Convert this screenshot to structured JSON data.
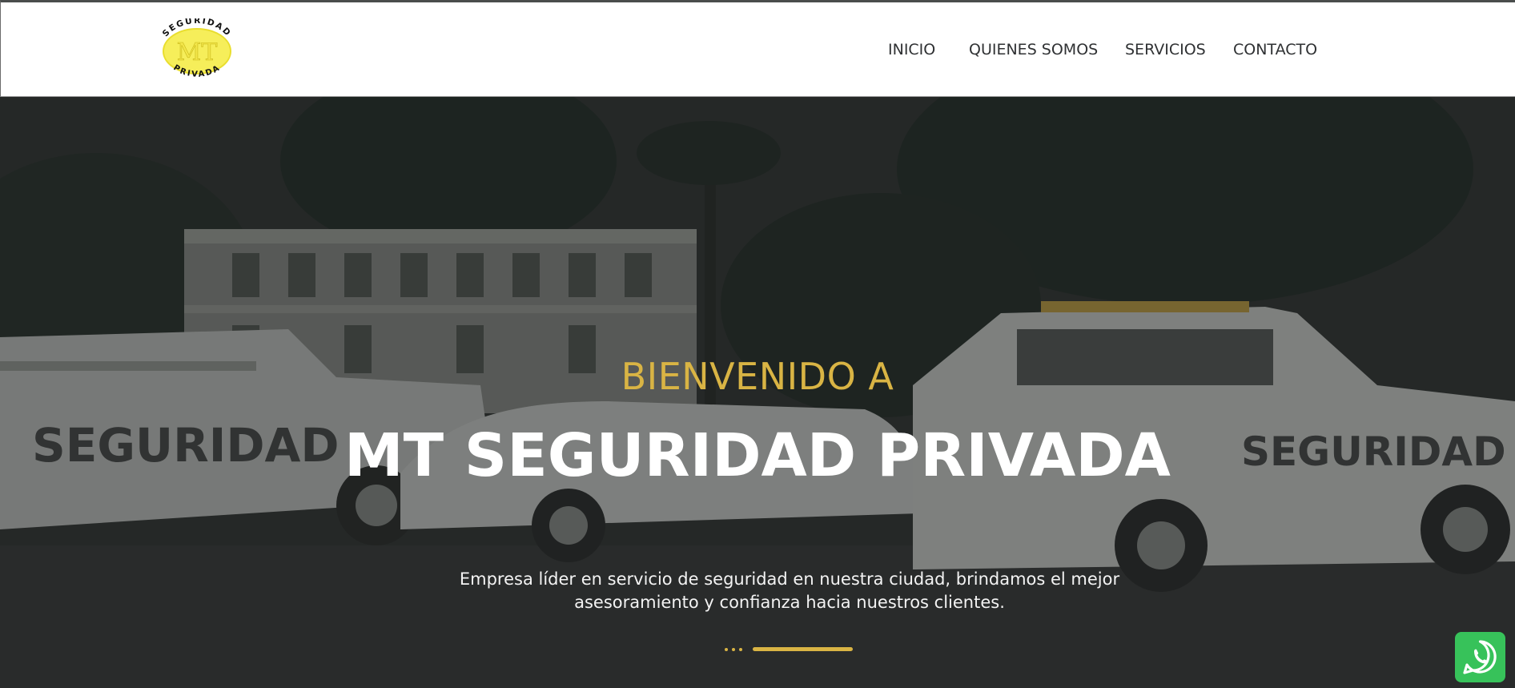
{
  "brand": {
    "logo_top_text": "SEGURIDAD",
    "logo_initials": "MT",
    "logo_bottom_text": "PRIVADA",
    "accent_color": "#d9b444",
    "logo_color": "#f3e64a"
  },
  "nav": {
    "items": [
      {
        "label": "INICIO"
      },
      {
        "label": "QUIENES SOMOS"
      },
      {
        "label": "SERVICIOS"
      },
      {
        "label": "CONTACTO"
      }
    ]
  },
  "hero": {
    "kicker": "BIENVENIDO A",
    "title": "MT SEGURIDAD PRIVADA",
    "description": "Empresa líder en servicio de seguridad en nuestra ciudad, brindamos el mejor asesoramiento y confianza hacia nuestros clientes.",
    "background_vehicle_text": "SEGURIDAD"
  },
  "widgets": {
    "whatsapp_icon": "whatsapp-icon"
  }
}
